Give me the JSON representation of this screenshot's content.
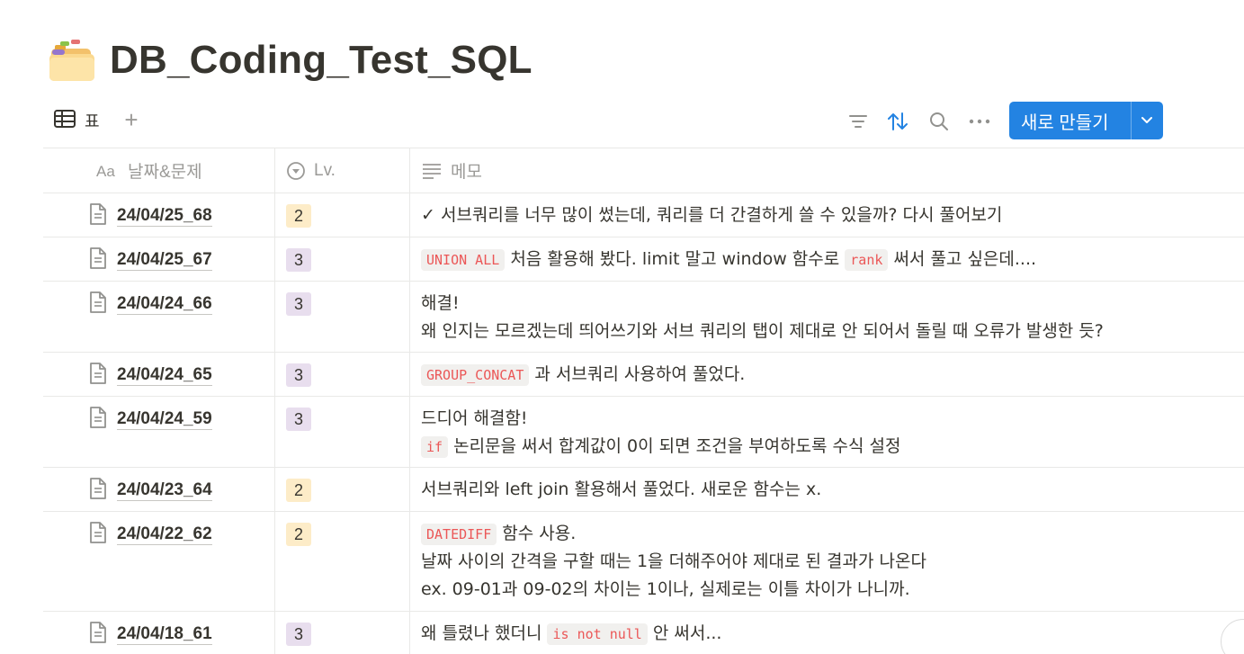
{
  "page": {
    "title": "DB_Coding_Test_SQL",
    "icon": "folder-icon"
  },
  "toolbar": {
    "view_tab_label": "표",
    "add_view_symbol": "+",
    "new_button_label": "새로 만들기"
  },
  "columns": {
    "name": "날짜&문제",
    "level": "Lv.",
    "memo": "메모"
  },
  "rows": [
    {
      "name": "24/04/25_68",
      "level": "2",
      "level_color": "#fdecc8",
      "memo": [
        [
          {
            "t": "✓ 서브쿼리를 너무 많이 썼는데, 쿼리를 더 간결하게 쓸 수 있을까? 다시 풀어보기"
          }
        ]
      ]
    },
    {
      "name": "24/04/25_67",
      "level": "3",
      "level_color": "#e8deee",
      "memo": [
        [
          {
            "code": "UNION ALL"
          },
          {
            "t": " 처음 활용해 봤다. limit 말고 window 함수로 "
          },
          {
            "code": "rank"
          },
          {
            "t": " 써서 풀고 싶은데...."
          }
        ]
      ]
    },
    {
      "name": "24/04/24_66",
      "level": "3",
      "level_color": "#e8deee",
      "memo": [
        [
          {
            "t": "해결!"
          }
        ],
        [
          {
            "t": "왜 인지는 모르겠는데 띄어쓰기와 서브 쿼리의 탭이 제대로 안 되어서 돌릴 때 오류가 발생한 듯?"
          }
        ]
      ]
    },
    {
      "name": "24/04/24_65",
      "level": "3",
      "level_color": "#e8deee",
      "memo": [
        [
          {
            "code": "GROUP_CONCAT"
          },
          {
            "t": " 과 서브쿼리 사용하여 풀었다."
          }
        ]
      ]
    },
    {
      "name": "24/04/24_59",
      "level": "3",
      "level_color": "#e8deee",
      "memo": [
        [
          {
            "t": "드디어 해결함!"
          }
        ],
        [
          {
            "code": "if"
          },
          {
            "t": " 논리문을 써서 합계값이 0이 되면 조건을 부여하도록 수식 설정"
          }
        ]
      ]
    },
    {
      "name": "24/04/23_64",
      "level": "2",
      "level_color": "#fdecc8",
      "memo": [
        [
          {
            "t": "서브쿼리와 left join 활용해서 풀었다. 새로운 함수는 x."
          }
        ]
      ]
    },
    {
      "name": "24/04/22_62",
      "level": "2",
      "level_color": "#fdecc8",
      "memo": [
        [
          {
            "code": "DATEDIFF"
          },
          {
            "t": " 함수 사용."
          }
        ],
        [
          {
            "t": "날짜 사이의 간격을 구할 때는 1을 더해주어야 제대로 된 결과가 나온다"
          }
        ],
        [
          {
            "t": "ex. 09-01과 09-02의 차이는 1이나, 실제로는 이틀 차이가 나니까."
          }
        ]
      ]
    },
    {
      "name": "24/04/18_61",
      "level": "3",
      "level_color": "#e8deee",
      "memo": [
        [
          {
            "t": "왜 틀렸나 했더니 "
          },
          {
            "code": "is not null"
          },
          {
            "t": " 안 써서..."
          }
        ]
      ]
    }
  ],
  "colors": {
    "accent": "#2383e2",
    "code_text": "#eb5757",
    "code_bg": "#f1f0ee"
  }
}
